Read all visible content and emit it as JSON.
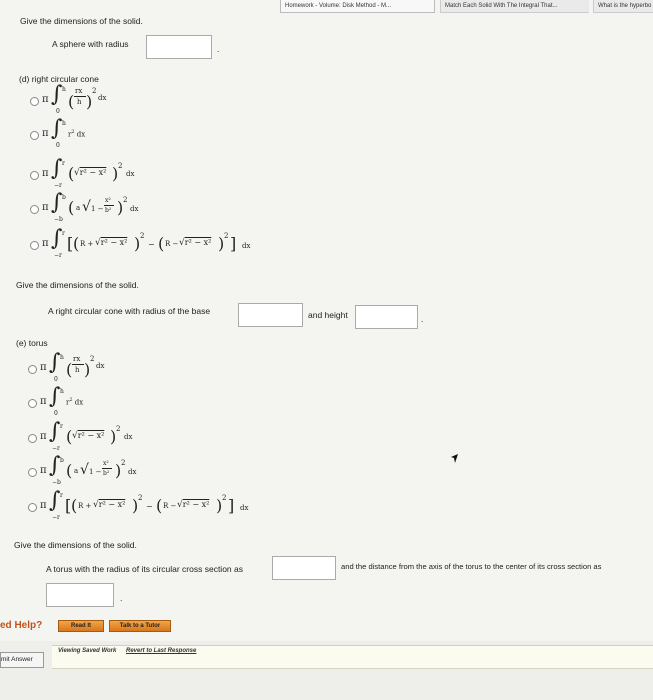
{
  "tabs": [
    "Homework - Volume: Disk Method - M...",
    "Match Each Solid With The Integral That...",
    "What is the hyperbo"
  ],
  "top_question": {
    "prompt": "Give the dimensions of the solid.",
    "label": "A sphere with radius",
    "suffix": "."
  },
  "part_d": {
    "title": "(d) right circular cone",
    "prompt": "Give the dimensions of the solid.",
    "label_a": "A right circular cone with radius of the base",
    "label_b": "and height",
    "suffix": "."
  },
  "part_e": {
    "title": "(e) torus",
    "prompt": "Give the dimensions of the solid.",
    "label_a": "A torus with the radius of its circular cross section as",
    "label_b": "and the distance from the axis of the torus to the center of its cross section as",
    "suffix": "."
  },
  "options": [
    {
      "expr": "π ∫₀ʰ (rx/h)² dx"
    },
    {
      "expr": "π ∫₀ʰ r² dx"
    },
    {
      "expr": "π ∫₋ᵣʳ (√(r² − x²))² dx"
    },
    {
      "expr": "π ∫₋ᵦᵇ (a√(1 − x²/b²))² dx"
    },
    {
      "expr": "π ∫₋ᵣʳ [(R + √(r² − x²))² − (R − √(r² − x²))²] dx"
    }
  ],
  "help": {
    "label": "ed Help?",
    "read_btn": "Read It",
    "tutor_btn": "Talk to a Tutor"
  },
  "footer": {
    "submit": "mit Answer",
    "viewing": "Viewing Saved Work",
    "revert": "Revert to Last Response"
  }
}
